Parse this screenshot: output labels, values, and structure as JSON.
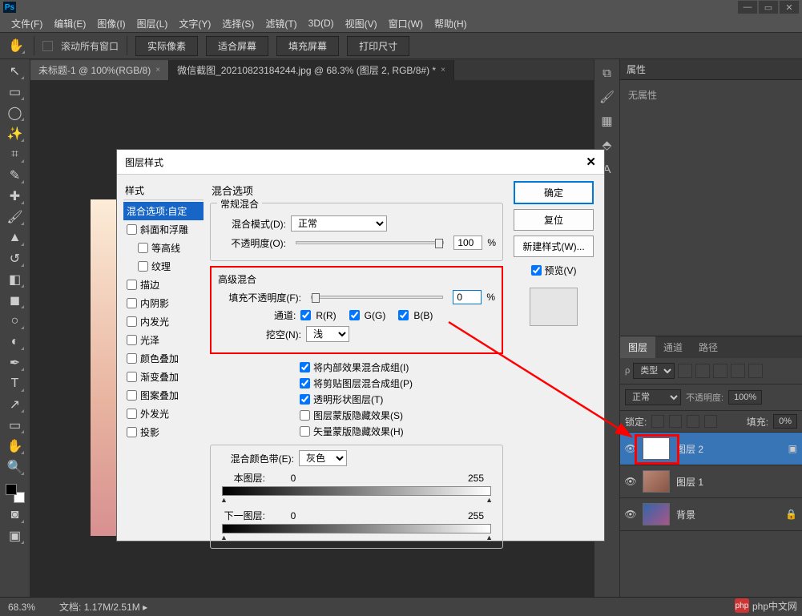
{
  "app": {
    "icon_text": "Ps"
  },
  "menus": [
    "文件(F)",
    "编辑(E)",
    "图像(I)",
    "图层(L)",
    "文字(Y)",
    "选择(S)",
    "滤镜(T)",
    "3D(D)",
    "视图(V)",
    "窗口(W)",
    "帮助(H)"
  ],
  "optbar": {
    "scroll_all": "滚动所有窗口",
    "actual": "实际像素",
    "fit": "适合屏幕",
    "fill": "填充屏幕",
    "print": "打印尺寸"
  },
  "tabs": [
    {
      "label": "未标题-1 @ 100%(RGB/8)",
      "active": false
    },
    {
      "label": "微信截图_20210823184244.jpg @ 68.3% (图层 2, RGB/8#) *",
      "active": true
    }
  ],
  "right_panel": {
    "props_title": "属性",
    "no_props": "无属性",
    "layer_tabs": [
      "图层",
      "通道",
      "路径"
    ],
    "kind_label": "类型",
    "blend_mode": "正常",
    "opacity_label": "不透明度:",
    "opacity_value": "100%",
    "lock_label": "锁定:",
    "fill_label": "填充:",
    "fill_value": "0%",
    "layers": [
      {
        "name": "图层 2",
        "selected": true,
        "thumb": "white"
      },
      {
        "name": "图层 1",
        "selected": false,
        "thumb": "img1"
      },
      {
        "name": "背景",
        "selected": false,
        "thumb": "img2",
        "locked": true
      }
    ]
  },
  "dialog": {
    "title": "图层样式",
    "styles_header": "样式",
    "styles": [
      {
        "label": "混合选项:自定",
        "selected": true,
        "checkbox": false
      },
      {
        "label": "斜面和浮雕",
        "checkbox": true
      },
      {
        "label": "等高线",
        "checkbox": true,
        "indent": true
      },
      {
        "label": "纹理",
        "checkbox": true,
        "indent": true
      },
      {
        "label": "描边",
        "checkbox": true
      },
      {
        "label": "内阴影",
        "checkbox": true
      },
      {
        "label": "内发光",
        "checkbox": true
      },
      {
        "label": "光泽",
        "checkbox": true
      },
      {
        "label": "颜色叠加",
        "checkbox": true
      },
      {
        "label": "渐变叠加",
        "checkbox": true
      },
      {
        "label": "图案叠加",
        "checkbox": true
      },
      {
        "label": "外发光",
        "checkbox": true
      },
      {
        "label": "投影",
        "checkbox": true
      }
    ],
    "blend_options_title": "混合选项",
    "general_blend": "常规混合",
    "blend_mode_label": "混合模式(D):",
    "blend_mode_value": "正常",
    "opacity_label": "不透明度(O):",
    "opacity_value": "100",
    "percent": "%",
    "advanced_blend": "高级混合",
    "fill_opacity_label": "填充不透明度(F):",
    "fill_opacity_value": "0",
    "channels_label": "通道:",
    "ch_r": "R(R)",
    "ch_g": "G(G)",
    "ch_b": "B(B)",
    "knockout_label": "挖空(N):",
    "knockout_value": "浅",
    "opt1": "将内部效果混合成组(I)",
    "opt2": "将剪贴图层混合成组(P)",
    "opt3": "透明形状图层(T)",
    "opt4": "图层蒙版隐藏效果(S)",
    "opt5": "矢量蒙版隐藏效果(H)",
    "blend_if_label": "混合颜色带(E):",
    "blend_if_value": "灰色",
    "this_layer": "本图层:",
    "underlying": "下一图层:",
    "range_low": "0",
    "range_high": "255",
    "btn_ok": "确定",
    "btn_cancel": "复位",
    "btn_new_style": "新建样式(W)...",
    "preview_label": "预览(V)"
  },
  "status": {
    "zoom": "68.3%",
    "doc_label": "文档:",
    "doc_value": "1.17M/2.51M"
  },
  "watermark": "php中文网"
}
